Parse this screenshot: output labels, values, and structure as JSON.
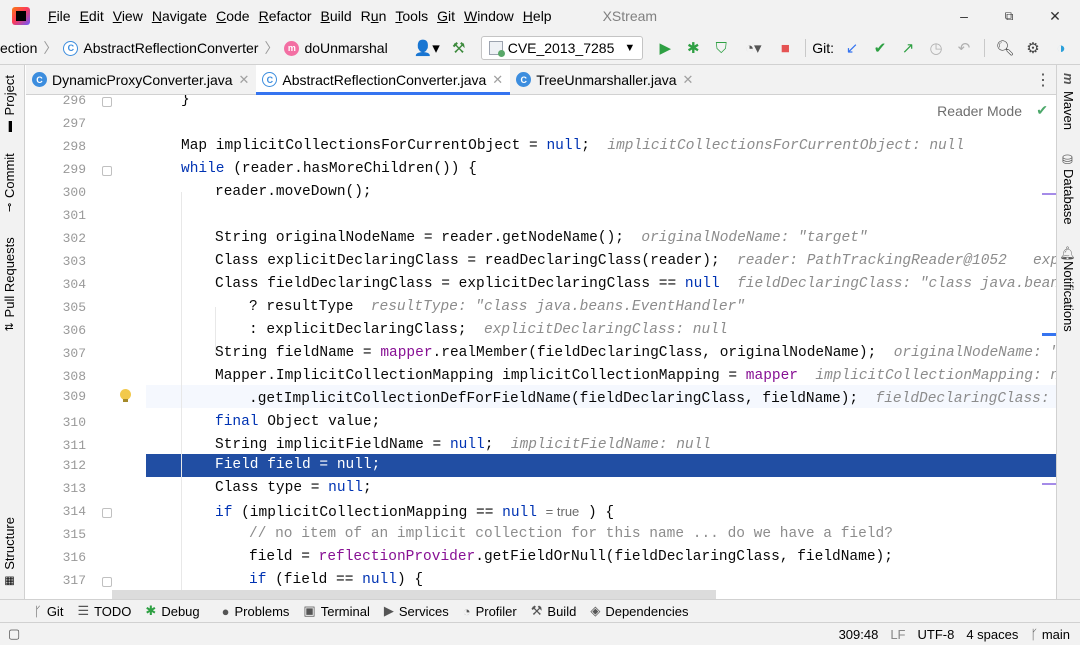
{
  "menu": [
    "File",
    "Edit",
    "View",
    "Navigate",
    "Code",
    "Refactor",
    "Build",
    "Run",
    "Tools",
    "Git",
    "Window",
    "Help"
  ],
  "menu_mnemonic": [
    "F",
    "E",
    "V",
    "N",
    "C",
    "R",
    "B",
    "u",
    "T",
    "G",
    "W",
    "H"
  ],
  "app_name": "XStream",
  "window_controls": {
    "minimize": "–",
    "restore": "⧉",
    "close": "✕"
  },
  "breadcrumbs": {
    "first": "ection",
    "class": "AbstractReflectionConverter",
    "method": "doUnmarshal"
  },
  "run_config": "CVE_2013_7285",
  "git_label": "Git:",
  "tabs": [
    {
      "label": "DynamicProxyConverter.java",
      "active": false
    },
    {
      "label": "AbstractReflectionConverter.java",
      "active": true
    },
    {
      "label": "TreeUnmarshaller.java",
      "active": false
    }
  ],
  "left_tools": [
    "Project",
    "Commit",
    "Pull Requests",
    "Structure"
  ],
  "right_tools": [
    "Maven",
    "Database",
    "Notifications"
  ],
  "reader_mode": "Reader Mode",
  "code": [
    {
      "n": "296",
      "html": "}"
    },
    {
      "n": "297",
      "html": ""
    },
    {
      "n": "298",
      "html": "Map implicitCollectionsForCurrentObject = null;"
    },
    {
      "n": "299",
      "html": "while (reader.hasMoreChildren()) {"
    },
    {
      "n": "300",
      "html": "reader.moveDown();"
    },
    {
      "n": "301",
      "html": ""
    },
    {
      "n": "302",
      "html": "String originalNodeName = reader.getNodeName();"
    },
    {
      "n": "303",
      "html": "Class explicitDeclaringClass = readDeclaringClass(reader);"
    },
    {
      "n": "304",
      "html": "Class fieldDeclaringClass = explicitDeclaringClass == null"
    },
    {
      "n": "305",
      "html": "? resultType"
    },
    {
      "n": "306",
      "html": ": explicitDeclaringClass;"
    },
    {
      "n": "307",
      "html": "String fieldName = mapper.realMember(fieldDeclaringClass, originalNodeName);"
    },
    {
      "n": "308",
      "html": "Mapper.ImplicitCollectionMapping implicitCollectionMapping = mapper"
    },
    {
      "n": "309",
      "html": ".getImplicitCollectionDefForFieldName(fieldDeclaringClass, fieldName);"
    },
    {
      "n": "310",
      "html": "final Object value;"
    },
    {
      "n": "311",
      "html": "String implicitFieldName = null;"
    },
    {
      "n": "312",
      "html": "Field field = null;"
    },
    {
      "n": "313",
      "html": "Class type = null;"
    },
    {
      "n": "314",
      "html": "if (implicitCollectionMapping == null = true ) {"
    },
    {
      "n": "315",
      "html": "// no item of an implicit collection for this name ... do we have a field?"
    },
    {
      "n": "316",
      "html": "field = reflectionProvider.getFieldOrNull(fieldDeclaringClass, fieldName);"
    },
    {
      "n": "317",
      "html": "if (field == null) {"
    }
  ],
  "hints": {
    "h298": "implicitCollectionsForCurrentObject: null",
    "h302": "originalNodeName: \"target\"",
    "h303a": "reader: PathTrackingReader@1052",
    "h303b": "expli",
    "h304": "fieldDeclaringClass: \"class java.beans.E",
    "h305": "resultType: \"class java.beans.EventHandler\"",
    "h306": "explicitDeclaringClass: null",
    "h307": "originalNodeName: \"tar",
    "h308": "implicitCollectionMapping: null",
    "h309": "fieldDeclaringClass: \"c",
    "h311": "implicitFieldName: null",
    "h314": "= true"
  },
  "bottom_tools": [
    {
      "icon": "git-icon",
      "glyph": "ᚴ",
      "label": "Git"
    },
    {
      "icon": "todo-icon",
      "glyph": "☰",
      "label": "TODO"
    },
    {
      "icon": "debug-icon",
      "glyph": "✱",
      "label": "Debug"
    },
    {
      "icon": "problems-icon",
      "glyph": "●",
      "label": "Problems"
    },
    {
      "icon": "terminal-icon",
      "glyph": "▣",
      "label": "Terminal"
    },
    {
      "icon": "services-icon",
      "glyph": "▶",
      "label": "Services"
    },
    {
      "icon": "profiler-icon",
      "glyph": "◔",
      "label": "Profiler"
    },
    {
      "icon": "build-icon",
      "glyph": "⚒",
      "label": "Build"
    },
    {
      "icon": "dependencies-icon",
      "glyph": "◈",
      "label": "Dependencies"
    }
  ],
  "status": {
    "position": "309:48",
    "line_sep": "LF",
    "encoding": "UTF-8",
    "indent": "4 spaces",
    "branch": "main"
  },
  "colors": {
    "accent": "#3574f0",
    "selection": "#214ea3",
    "keyword": "#0033b3",
    "field": "#871094"
  }
}
